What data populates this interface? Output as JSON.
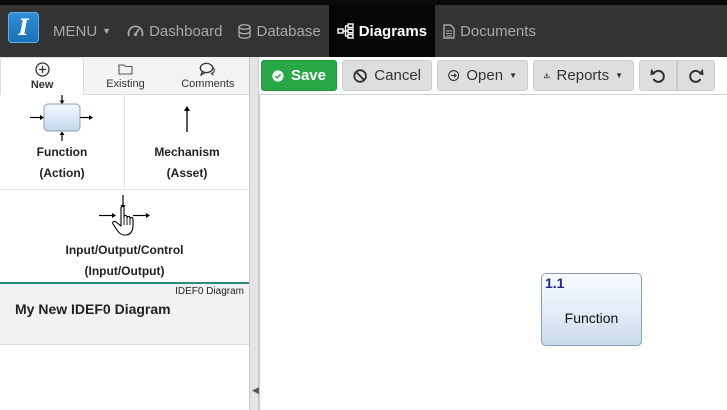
{
  "app": {
    "logo_letter": "I"
  },
  "nav": {
    "menu_label": "MENU",
    "items": [
      {
        "label": "Dashboard",
        "icon": "speedometer-icon"
      },
      {
        "label": "Database",
        "icon": "database-icon"
      },
      {
        "label": "Diagrams",
        "icon": "sitemap-icon",
        "active": true
      },
      {
        "label": "Documents",
        "icon": "document-icon"
      }
    ]
  },
  "left_tabs": [
    {
      "label": "New",
      "icon": "plus-circle-icon",
      "active": true
    },
    {
      "label": "Existing",
      "icon": "folder-icon"
    },
    {
      "label": "Comments",
      "icon": "comments-icon"
    }
  ],
  "palette": {
    "function": {
      "line1": "Function",
      "line2": "(Action)"
    },
    "mechanism": {
      "line1": "Mechanism",
      "line2": "(Asset)"
    },
    "ioc": {
      "line1": "Input/Output/Control",
      "line2": "(Input/Output)"
    }
  },
  "diagram_card": {
    "type": "IDEF0 Diagram",
    "title": "My New IDEF0 Diagram"
  },
  "toolbar": {
    "save": "Save",
    "cancel": "Cancel",
    "open": "Open",
    "reports": "Reports"
  },
  "canvas": {
    "nodes": [
      {
        "number": "1.1",
        "label": "Function"
      }
    ]
  },
  "colors": {
    "save_green": "#28a745",
    "navbar": "#333333",
    "card_accent": "#2e8b7d",
    "node_number": "#23278a"
  }
}
